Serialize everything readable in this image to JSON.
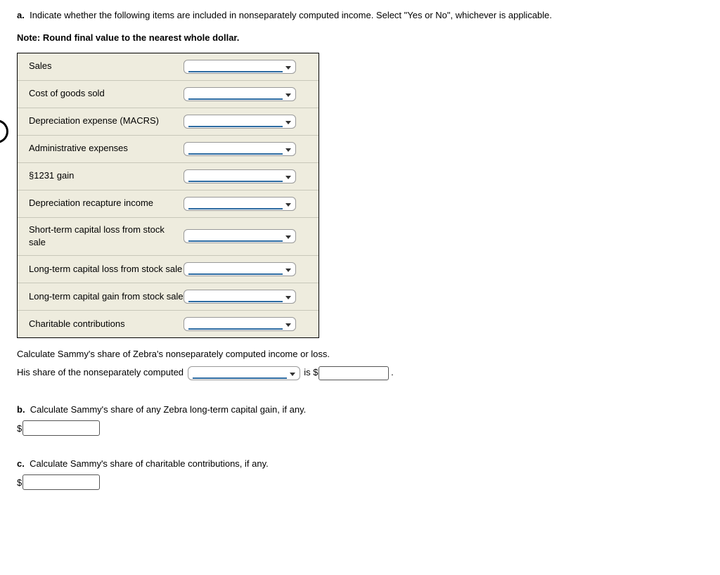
{
  "part_a": {
    "letter": "a.",
    "prompt": "Indicate whether the following items are included in nonseparately computed income. Select \"Yes or No\", whichever is applicable.",
    "note_prefix": "Note:",
    "note_text": " Round final value to the nearest whole dollar."
  },
  "items": [
    {
      "label": "Sales"
    },
    {
      "label": "Cost of goods sold"
    },
    {
      "label": "Depreciation expense (MACRS)"
    },
    {
      "label": "Administrative expenses"
    },
    {
      "label": "§1231 gain"
    },
    {
      "label": "Depreciation recapture income"
    },
    {
      "label": "Short-term capital loss from stock sale"
    },
    {
      "label": "Long-term capital loss from stock sale"
    },
    {
      "label": "Long-term capital gain from stock sale"
    },
    {
      "label": "Charitable contributions"
    }
  ],
  "calc": {
    "line1": "Calculate Sammy's share of Zebra's nonseparately computed income or loss.",
    "line2_pre": "His share of the nonseparately computed ",
    "is_word": " is $",
    "period": " ."
  },
  "part_b": {
    "letter": "b.",
    "prompt": "Calculate Sammy's share of any Zebra long-term capital gain, if any.",
    "currency": "$"
  },
  "part_c": {
    "letter": "c.",
    "prompt": "Calculate Sammy's share of charitable contributions, if any.",
    "currency": "$"
  }
}
